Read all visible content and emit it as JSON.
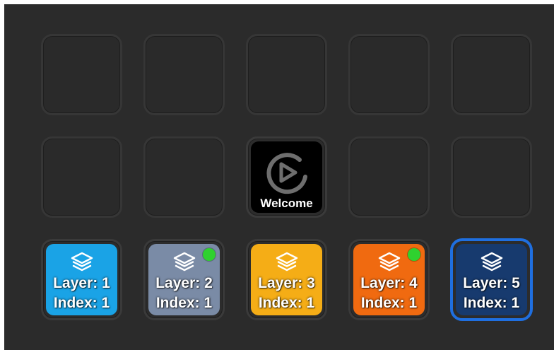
{
  "grid": {
    "welcome_key": {
      "label": "Welcome",
      "icon": "elgato-logo-icon"
    },
    "layer_keys": [
      {
        "layer_label": "Layer: 1",
        "index_label": "Index: 1",
        "color": "#1aa3e6",
        "status_active": false,
        "selected": false
      },
      {
        "layer_label": "Layer: 2",
        "index_label": "Index: 1",
        "color": "#7a8ba6",
        "status_active": true,
        "selected": false
      },
      {
        "layer_label": "Layer: 3",
        "index_label": "Index: 1",
        "color": "#f5ad16",
        "status_active": false,
        "selected": false
      },
      {
        "layer_label": "Layer: 4",
        "index_label": "Index: 1",
        "color": "#f06a10",
        "status_active": true,
        "selected": false
      },
      {
        "layer_label": "Layer: 5",
        "index_label": "Index: 1",
        "color": "#173a6e",
        "status_active": false,
        "selected": true
      }
    ],
    "status_color": "#2fd12f",
    "selected_border_color": "#1f6fe0"
  }
}
